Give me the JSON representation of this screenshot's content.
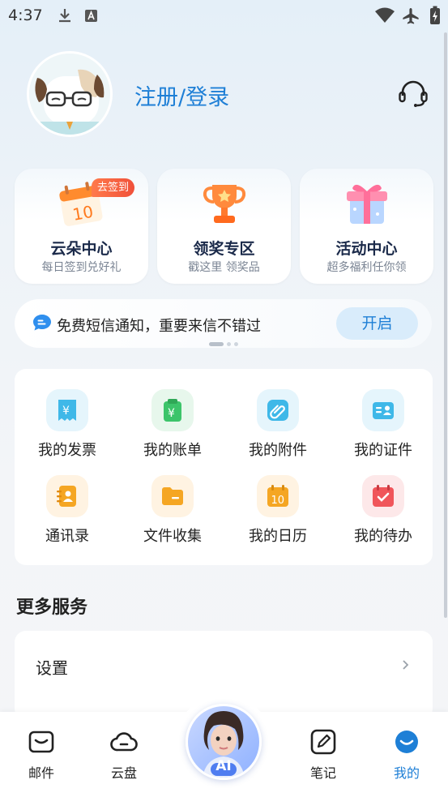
{
  "status_bar": {
    "time": "4:37"
  },
  "profile": {
    "login_label": "注册/登录"
  },
  "quick_cards": [
    {
      "title": "云朵中心",
      "subtitle": "每日签到兑好礼",
      "badge": "去签到",
      "icon": "calendar-icon"
    },
    {
      "title": "领奖专区",
      "subtitle": "戳这里 领奖品",
      "icon": "trophy-icon"
    },
    {
      "title": "活动中心",
      "subtitle": "超多福利任你领",
      "icon": "gift-icon"
    }
  ],
  "notice": {
    "text": "免费短信通知，重要来信不错过",
    "button": "开启"
  },
  "tools": [
    {
      "label": "我的发票",
      "icon": "invoice-icon",
      "color": "#3fb8e8"
    },
    {
      "label": "我的账单",
      "icon": "bill-icon",
      "color": "#3cc46a"
    },
    {
      "label": "我的附件",
      "icon": "attachment-icon",
      "color": "#3fb8e8"
    },
    {
      "label": "我的证件",
      "icon": "id-card-icon",
      "color": "#3fb8e8"
    },
    {
      "label": "通讯录",
      "icon": "contacts-icon",
      "color": "#f5a623"
    },
    {
      "label": "文件收集",
      "icon": "folder-icon",
      "color": "#f5a623"
    },
    {
      "label": "我的日历",
      "icon": "calendar-icon",
      "color": "#f5a623"
    },
    {
      "label": "我的待办",
      "icon": "todo-icon",
      "color": "#f0555a"
    }
  ],
  "more_services": {
    "title": "更多服务",
    "settings_label": "设置"
  },
  "bottom_nav": [
    {
      "label": "邮件",
      "icon": "mail-icon"
    },
    {
      "label": "云盘",
      "icon": "cloud-icon"
    },
    {
      "label": "AI",
      "icon": "ai-assistant-icon"
    },
    {
      "label": "笔记",
      "icon": "note-icon"
    },
    {
      "label": "我的",
      "icon": "profile-icon",
      "active": true
    }
  ],
  "colors": {
    "accent": "#1e7fd6",
    "badge": "#f0503a"
  }
}
